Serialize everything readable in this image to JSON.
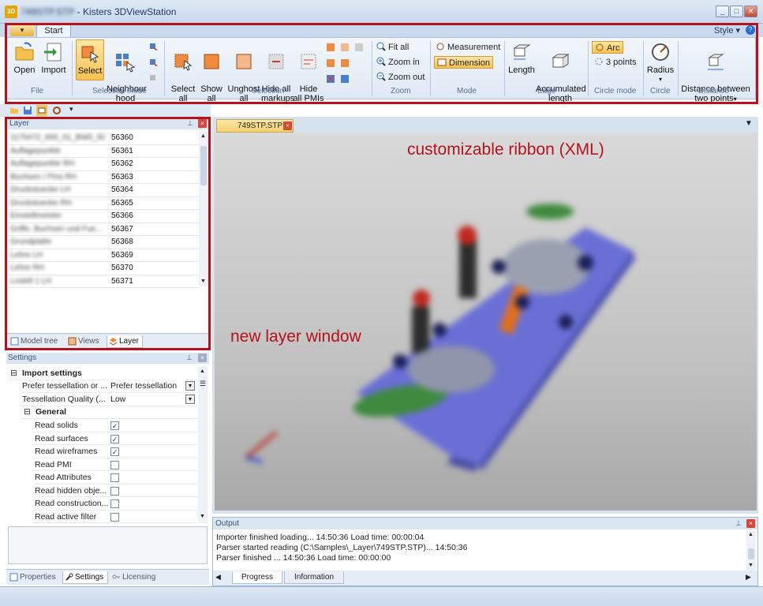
{
  "window": {
    "title_blurred": "749STP.STP",
    "title": "Kisters 3DViewStation",
    "controls": [
      "_",
      "□",
      "✕"
    ]
  },
  "ribbon": {
    "app_menu_icon": "app-menu-icon",
    "tab": "Start",
    "style_menu": "Style",
    "help": "?",
    "groups": {
      "file": {
        "label": "File",
        "open": "Open",
        "import": "Import"
      },
      "selection_mode": {
        "label": "Selection mode",
        "select": "Select",
        "neighbourhood": "Neighbour\nhood"
      },
      "selection": {
        "label": "Selection",
        "select_all": "Select\nall",
        "show_all": "Show\nall",
        "unghost_all": "Unghost\nall",
        "hide_all_markups": "Hide all\nmarkups",
        "hide_all_pmis": "Hide\nall PMIs"
      },
      "zoom": {
        "label": "Zoom",
        "fit_all": "Fit all",
        "zoom_in": "Zoom in",
        "zoom_out": "Zoom out"
      },
      "mode": {
        "label": "Mode",
        "measurement": "Measurement",
        "dimension": "Dimension"
      },
      "edge": {
        "label": "Edge",
        "length": "Length",
        "accumulated_length": "Accumulated\nlength"
      },
      "circle_mode": {
        "label": "Circle mode",
        "arc": "Arc",
        "three_points": "3 points"
      },
      "circle": {
        "label": "Circle",
        "radius": "Radius"
      },
      "distance": {
        "label": "Distance",
        "between_two_points": "Distance between\ntwo points"
      }
    }
  },
  "layer_panel": {
    "title": "Layer",
    "rows": [
      {
        "name": "1170472_000_01_BW0_50...",
        "id": "56360"
      },
      {
        "name": "Auflagepunkte",
        "id": "56361"
      },
      {
        "name": "Auflagepunkte RH",
        "id": "56362"
      },
      {
        "name": "Buchsen / Pins RH",
        "id": "56363"
      },
      {
        "name": "Druckstuecke LH",
        "id": "56364"
      },
      {
        "name": "Druckstuecke RH",
        "id": "56365"
      },
      {
        "name": "Einstellmeister",
        "id": "56366"
      },
      {
        "name": "Griffe, Buchsen und Fue...",
        "id": "56367"
      },
      {
        "name": "Grundplatte",
        "id": "56368"
      },
      {
        "name": "Lehre LH",
        "id": "56369"
      },
      {
        "name": "Lehre RH",
        "id": "56370"
      },
      {
        "name": "Loslell 1 LH",
        "id": "56371"
      }
    ],
    "tabs": [
      "Model tree",
      "Views",
      "Layer"
    ]
  },
  "settings_panel": {
    "title": "Settings",
    "import_settings": "Import settings",
    "pref_tessellation_label": "Prefer tessellation or ...",
    "pref_tessellation_value": "Prefer tessellation",
    "tess_quality_label": "Tessellation Quality (...",
    "tess_quality_value": "Low",
    "general": "General",
    "options": [
      {
        "label": "Read solids",
        "checked": true
      },
      {
        "label": "Read surfaces",
        "checked": true
      },
      {
        "label": "Read wireframes",
        "checked": true
      },
      {
        "label": "Read PMI",
        "checked": false
      },
      {
        "label": "Read Attributes",
        "checked": false
      },
      {
        "label": "Read hidden obje...",
        "checked": false
      },
      {
        "label": "Read construction...",
        "checked": false
      },
      {
        "label": "Read active filter",
        "checked": false
      }
    ],
    "tabs": [
      "Properties",
      "Settings",
      "Licensing"
    ]
  },
  "document": {
    "tab": "749STP.STP",
    "annotation_ribbon": "customizable ribbon (XML)",
    "annotation_layer": "new layer window"
  },
  "output_panel": {
    "title": "Output",
    "lines": [
      "Importer finished loading... 14:50:36 Load time: 00:00:04",
      "Parser started reading (C:\\Samples\\_Layer\\749STP.STP)... 14:50:36",
      "Parser finished ... 14:50:36 Load time: 00:00:00"
    ],
    "tabs": [
      "Progress",
      "Information"
    ]
  },
  "colors": {
    "highlight_red": "#b5121b",
    "ribbon_bg": "#dfe9f5",
    "selected": "#f7c24f"
  }
}
